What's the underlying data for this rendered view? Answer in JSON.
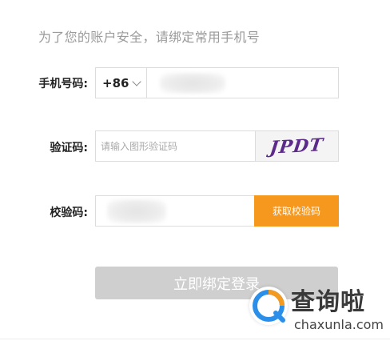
{
  "notice": "为了您的账户安全，请绑定常用手机号",
  "phone": {
    "label": "手机号码:",
    "country_code": "+86",
    "value": ""
  },
  "captcha": {
    "label": "验证码:",
    "placeholder": "请输入图形验证码",
    "image_text": "JPDT"
  },
  "verify": {
    "label": "校验码:",
    "value": "",
    "get_code_label": "获取校验码"
  },
  "submit_label": "立即绑定登录",
  "watermark": {
    "title": "查询啦",
    "url": "chaxunla.com"
  },
  "colors": {
    "accent": "#f7981e",
    "submit_disabled": "#cfcfcf",
    "logo_blue": "#2b8ee8",
    "logo_orange": "#f39a1f"
  }
}
